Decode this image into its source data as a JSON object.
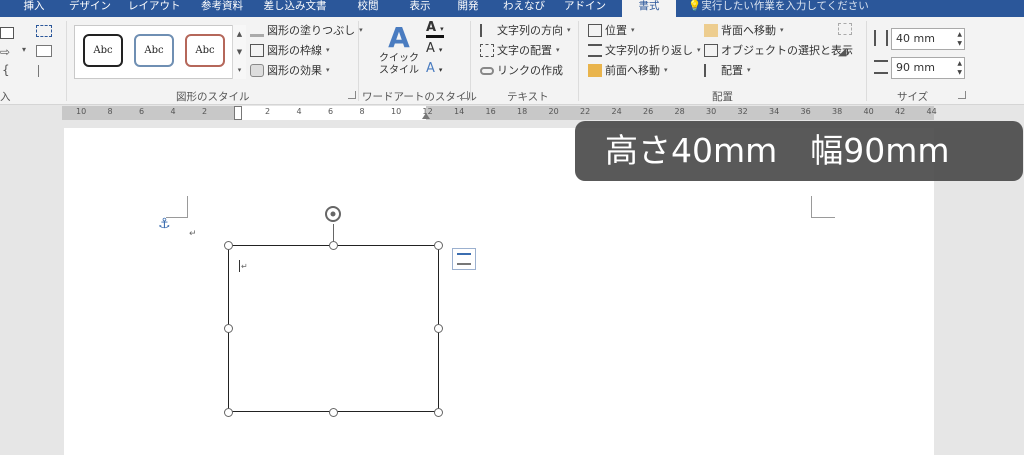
{
  "tabs": [
    {
      "label": "挿入"
    },
    {
      "label": "デザイン"
    },
    {
      "label": "レイアウト"
    },
    {
      "label": "参考資料"
    },
    {
      "label": "差し込み文書"
    },
    {
      "label": "校閲"
    },
    {
      "label": "表示"
    },
    {
      "label": "開発"
    },
    {
      "label": "わえなび"
    },
    {
      "label": "アドイン"
    },
    {
      "label": "書式"
    }
  ],
  "tell_me": "実行したい作業を入力してください",
  "ribbon": {
    "insert_shapes_group_label": "入",
    "shape_styles": {
      "label": "図形のスタイル",
      "presets": [
        "Abc",
        "Abc",
        "Abc"
      ],
      "fill": "図形の塗りつぶし",
      "outline": "図形の枠線",
      "effects": "図形の効果"
    },
    "wordart": {
      "label": "ワードアートのスタイル",
      "quick_style": "クイック\nスタイル"
    },
    "text": {
      "label": "テキスト",
      "direction": "文字列の方向",
      "align": "文字の配置",
      "link": "リンクの作成"
    },
    "arrange": {
      "label": "配置",
      "position": "位置",
      "wrap": "文字列の折り返し",
      "bring_forward": "前面へ移動",
      "send_backward": "背面へ移動",
      "selection_pane": "オブジェクトの選択と表示",
      "align": "配置"
    },
    "size": {
      "label": "サイズ",
      "height": "40 mm",
      "width": "90 mm"
    }
  },
  "ruler_numbers": [
    "10",
    "8",
    "6",
    "4",
    "2",
    "",
    "2",
    "4",
    "6",
    "8",
    "10",
    "12",
    "14",
    "16",
    "18",
    "20",
    "22",
    "24",
    "26",
    "28",
    "30",
    "32",
    "34",
    "36",
    "38",
    "40",
    "42",
    "44"
  ],
  "overlay_text": "高さ40mm　幅90mm",
  "colors": {
    "tabbar": "#2b579a",
    "preset1": "#222222",
    "preset2": "#6f8fb3",
    "preset3": "#b5675a"
  }
}
